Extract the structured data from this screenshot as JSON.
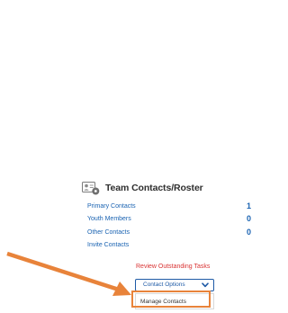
{
  "panel": {
    "title": "Team Contacts/Roster",
    "icon": "contacts-settings-icon"
  },
  "contacts": [
    {
      "label": "Primary Contacts",
      "count": "1"
    },
    {
      "label": "Youth Members",
      "count": "0"
    },
    {
      "label": "Other Contacts",
      "count": "0"
    }
  ],
  "invite_label": "Invite Contacts",
  "review_label": "Review Outstanding Tasks",
  "dropdown": {
    "label": "Contact Options",
    "icon": "chevron-down-icon",
    "menu_item": "Manage Contacts"
  },
  "annotation": {
    "arrow_color": "#e8833a",
    "highlight_color": "#e8833a"
  },
  "colors": {
    "link": "#1a63b2",
    "review": "#d93333",
    "dropdown_border": "#1e5aa6"
  }
}
